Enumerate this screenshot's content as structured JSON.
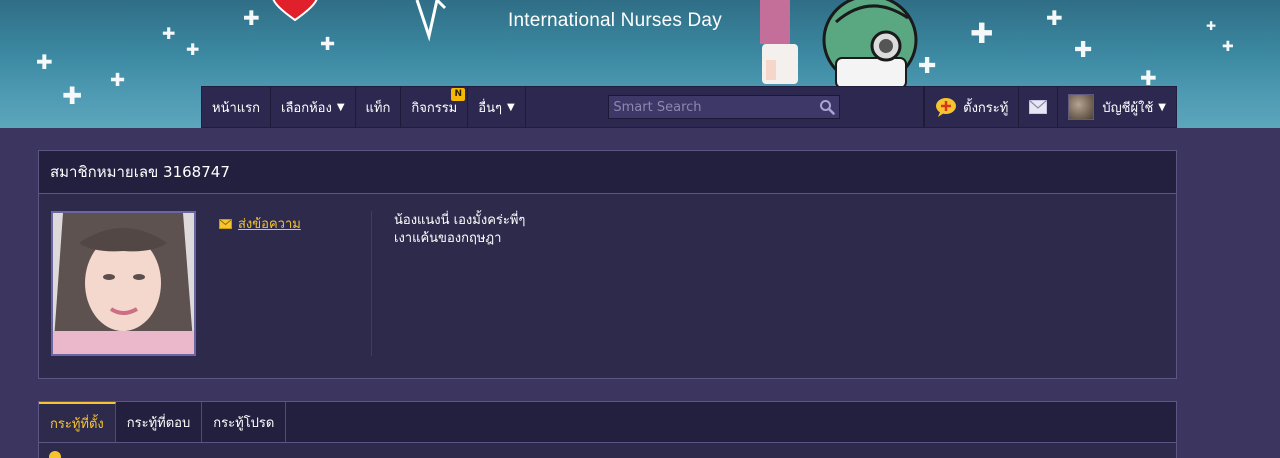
{
  "banner": {
    "title": "International Nurses Day"
  },
  "nav": {
    "items": [
      {
        "label": "หน้าแรก",
        "caret": false
      },
      {
        "label": "เลือกห้อง",
        "caret": true
      },
      {
        "label": "แท็ก",
        "caret": false
      },
      {
        "label": "กิจกรรม",
        "caret": false,
        "badge": "N"
      },
      {
        "label": "อื่นๆ",
        "caret": true
      }
    ],
    "search_placeholder": "Smart Search",
    "new_topic_label": "ตั้งกระทู้",
    "account_label": "บัญชีผู้ใช้"
  },
  "profile": {
    "title": "สมาชิกหมายเลข 3168747",
    "send_message": "ส่งข้อความ",
    "bio_line1": "น้องแนงนี่ เองมั้งคร่ะพี่ๆ",
    "bio_line2": "เงาแค้นของกฤษฎา"
  },
  "tabs": [
    {
      "label": "กระทู้ที่ตั้ง",
      "active": true
    },
    {
      "label": "กระทู้ที่ตอบ",
      "active": false
    },
    {
      "label": "กระทู้โปรด",
      "active": false
    }
  ],
  "colors": {
    "accent": "#f6c42f",
    "page_bg": "#3b3560",
    "navbar_bg": "#2c2850"
  }
}
